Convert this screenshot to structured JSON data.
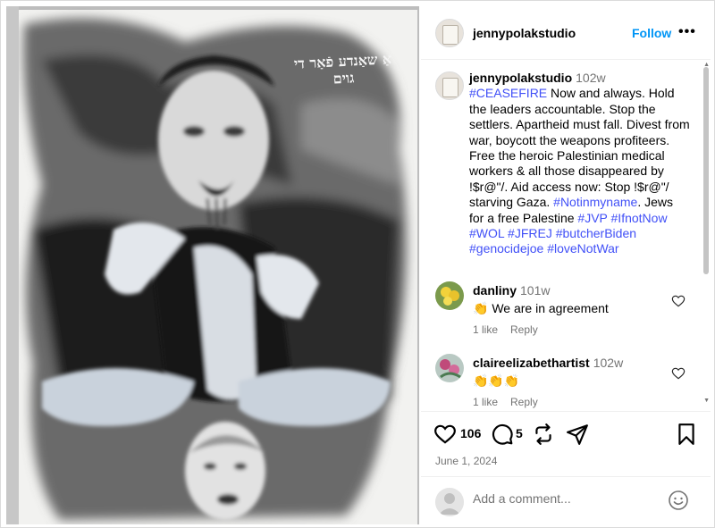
{
  "post": {
    "username": "jennypolakstudio",
    "follow_label": "Follow",
    "more_label": "•••",
    "artwork_text": "אַ שאַנדע פֿאַר די גוים"
  },
  "caption": {
    "username": "jennypolakstudio",
    "time": "102w",
    "segments": [
      {
        "text": "#CEASEFIRE",
        "tag": true
      },
      {
        "text": " Now and always. Hold the leaders accountable. Stop the settlers. Apartheid must fall. Divest from war, boycott the weapons profiteers. Free the heroic Palestinian medical workers & all those disappeared by !$r@\"/. Aid access now: Stop !$r@\"/ starving Gaza. ",
        "tag": false
      },
      {
        "text": "#Notinmyname",
        "tag": true
      },
      {
        "text": ". Jews for a free Palestine ",
        "tag": false
      },
      {
        "text": "#JVP",
        "tag": true
      },
      {
        "text": " ",
        "tag": false
      },
      {
        "text": "#IfnotNow",
        "tag": true
      },
      {
        "text": " ",
        "tag": false
      },
      {
        "text": "#WOL",
        "tag": true
      },
      {
        "text": " ",
        "tag": false
      },
      {
        "text": "#JFREJ",
        "tag": true
      },
      {
        "text": " ",
        "tag": false
      },
      {
        "text": "#butcherBiden",
        "tag": true
      },
      {
        "text": " ",
        "tag": false
      },
      {
        "text": "#genocidejoe",
        "tag": true
      },
      {
        "text": " ",
        "tag": false
      },
      {
        "text": "#loveNotWar",
        "tag": true
      }
    ]
  },
  "comments": [
    {
      "username": "danliny",
      "time": "101w",
      "text": "👏 We are in agreement",
      "likes": "1 like",
      "reply": "Reply"
    },
    {
      "username": "claireelizabethartist",
      "time": "102w",
      "text": "👏👏👏",
      "likes": "1 like",
      "reply": "Reply"
    }
  ],
  "actions": {
    "like_count": "106",
    "comment_count": "5",
    "date": "June 1, 2024"
  },
  "add_comment": {
    "placeholder": "Add a comment..."
  },
  "colors": {
    "follow": "#0095f6",
    "hashtag": "#4150f7",
    "muted": "#737373"
  }
}
